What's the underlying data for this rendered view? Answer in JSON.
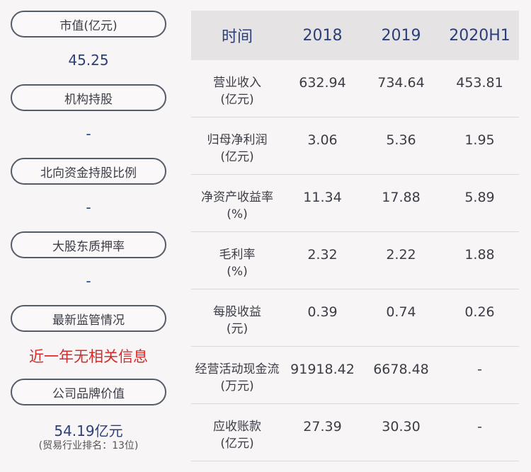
{
  "left": {
    "items": [
      {
        "label": "市值(亿元)",
        "value": "45.25"
      },
      {
        "label": "机构持股",
        "value": "-"
      },
      {
        "label": "北向资金持股比例",
        "value": "-"
      },
      {
        "label": "大股东质押率",
        "value": "-"
      },
      {
        "label": "最新监管情况",
        "value": "近一年无相关信息"
      },
      {
        "label": "公司品牌价值",
        "value": "54.19亿元",
        "sub": "(贸易行业排名：13位)"
      }
    ]
  },
  "table": {
    "headers": [
      "时间",
      "2018",
      "2019",
      "2020H1"
    ],
    "rows": [
      {
        "name": "营业收入",
        "unit": "(亿元)",
        "values": [
          "632.94",
          "734.64",
          "453.81"
        ]
      },
      {
        "name": "归母净利润",
        "unit": "(亿元)",
        "values": [
          "3.06",
          "5.36",
          "1.95"
        ]
      },
      {
        "name": "净资产收益率",
        "unit": "(%)",
        "values": [
          "11.34",
          "17.88",
          "5.89"
        ]
      },
      {
        "name": "毛利率",
        "unit": "(%)",
        "values": [
          "2.32",
          "2.22",
          "1.88"
        ]
      },
      {
        "name": "每股收益",
        "unit": "(元)",
        "values": [
          "0.39",
          "0.74",
          "0.26"
        ]
      },
      {
        "name": "经营活动现金流",
        "unit": "(万元)",
        "values": [
          "91918.42",
          "6678.48",
          "-"
        ]
      },
      {
        "name": "应收账款",
        "unit": "(亿元)",
        "values": [
          "27.39",
          "30.30",
          "-"
        ]
      }
    ]
  }
}
